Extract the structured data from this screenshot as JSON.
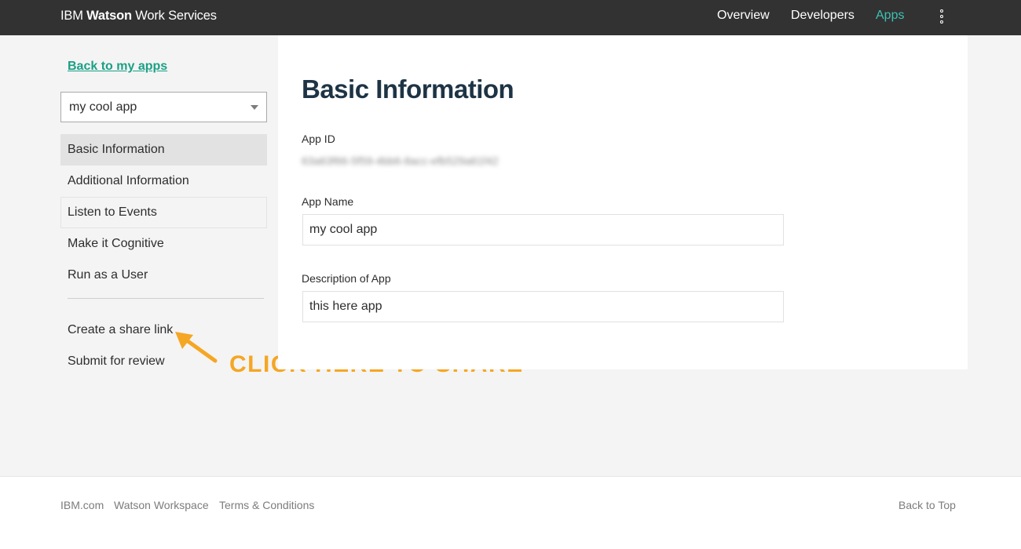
{
  "header": {
    "brand_prefix": "IBM",
    "brand_bold": "Watson",
    "brand_suffix": "Work Services",
    "nav": [
      {
        "label": "Overview"
      },
      {
        "label": "Developers"
      },
      {
        "label": "Apps",
        "active": true
      }
    ],
    "menu_icon": "kebab-menu-icon"
  },
  "sidebar": {
    "back_link": "Back to my apps",
    "app_select": {
      "selected": "my cool app"
    },
    "items": [
      {
        "label": "Basic Information",
        "active": true
      },
      {
        "label": "Additional Information"
      },
      {
        "label": "Listen to Events"
      },
      {
        "label": "Make it Cognitive"
      },
      {
        "label": "Run as a User"
      }
    ],
    "actions": [
      {
        "label": "Create a share link"
      },
      {
        "label": "Submit for review"
      }
    ]
  },
  "annotation": {
    "text": "CLICK HERE TO SHARE",
    "arrow_icon": "arrow-pointer-icon"
  },
  "main": {
    "title": "Basic Information",
    "app_id_label": "App ID",
    "app_id_value": "63a63f66-5f59-4bb6-8acc-efb529a61f42",
    "app_name_label": "App Name",
    "app_name_value": "my cool app",
    "description_label": "Description of App",
    "description_value": "this here app"
  },
  "footer": {
    "links": [
      "IBM.com",
      "Watson Workspace",
      "Terms & Conditions"
    ],
    "back_to_top": "Back to Top"
  },
  "colors": {
    "topbar": "#323232",
    "accent": "#3fc0b1",
    "link": "#1aa085",
    "title": "#1e3445",
    "callout": "#f5a623"
  }
}
